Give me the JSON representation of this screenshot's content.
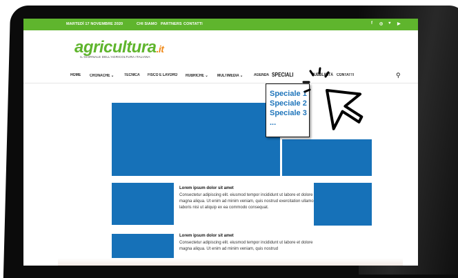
{
  "topbar": {
    "date": "MARTEDÌ 17 NOVEMBRE 2020",
    "links": [
      "CHI SIAMO",
      "PARTNERS",
      "CONTATTI"
    ],
    "social_icons": [
      "facebook-icon",
      "instagram-icon",
      "twitter-icon",
      "youtube-icon"
    ],
    "social_glyphs": [
      "f",
      "◎",
      "♥",
      "▶"
    ]
  },
  "logo": {
    "main": "agricultura",
    "suffix": ".it",
    "tagline": "IL GIORNALE DELL'AGRICOLTURA ITALIANA"
  },
  "nav": {
    "items": [
      "HOME",
      "CRONACHE",
      "TECNICA",
      "FISCO E LAVORO",
      "RUBRICHE",
      "MULTIMEDIA",
      "AGENDA",
      "SPECIALI",
      "PUBBLICITÀ",
      "CONTATTI"
    ],
    "caret": "⌄",
    "search_glyph": "⚲"
  },
  "dropdown": {
    "items": [
      "Speciale 1",
      "Speciale 2",
      "Speciale 3",
      "..."
    ]
  },
  "articles": [
    {
      "title": "Lorem ipsum dolor sit amet",
      "body": "Consectetur adipiscing elit. eiusmod tempor incididunt ut labore et dolore magna aliqua. Ut enim ad minim veniam, quis nostrud exercitation ullamco laboris nisi ut aliquip ex ea commodo consequat."
    },
    {
      "title": "Lorem ipsum dolor sit amet",
      "body": "Consectetur adipiscing elit. eiusmod tempor incididunt ut labore et dolore magna aliqua. Ut enim ad minim veniam, quis nostrud"
    }
  ],
  "colors": {
    "brand_green": "#5fb52d",
    "brand_orange": "#f08a1a",
    "block_blue": "#1671b8",
    "dropdown_text": "#1f75bb"
  }
}
